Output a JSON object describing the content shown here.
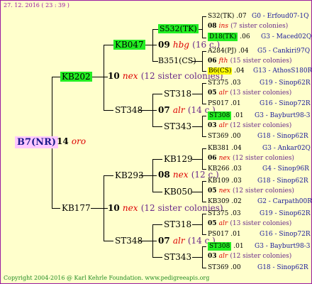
{
  "header": {
    "date": "27. 12. 2016 ( 23 : 39 )"
  },
  "footer": {
    "copyright": "Copyright 2004-2016 @ Karl Kehrle Foundation.   www.pedigreeapis.org"
  },
  "root": {
    "name": "B7(NR)",
    "gen": "14",
    "race": "oro"
  },
  "sire": {
    "name": "KB202",
    "gen": "10",
    "race": "nex",
    "sisters": "(12 sister colonies)"
  },
  "dam": {
    "name": "KB177",
    "gen": "10",
    "race": "nex",
    "sisters": "(12 sister colonies)"
  },
  "sire_sire": {
    "name": "KB047"
  },
  "sire_dam": {
    "name": "ST348",
    "gen": "07",
    "race": "alr",
    "sisters": "(14 c.)"
  },
  "dam_sire": {
    "name": "KB293",
    "gen": "08",
    "race": "nex",
    "sisters": "(12 c.)"
  },
  "dam_dam": {
    "name": "ST348",
    "gen": "07",
    "race": "alr",
    "sisters": "(14 c.)"
  },
  "g3": {
    "s532": {
      "name": "S532(TK)"
    },
    "b351": {
      "name": "B351(CS)"
    },
    "mid_gen": {
      "gen": "09",
      "race": "hbg",
      "sisters": "(16 c.)"
    },
    "st318a": {
      "name": "ST318"
    },
    "st343a": {
      "name": "ST343"
    },
    "kb129": {
      "name": "KB129"
    },
    "kb050": {
      "name": "KB050"
    },
    "st318b": {
      "name": "ST318"
    },
    "st343b": {
      "name": "ST343"
    }
  },
  "g4": [
    {
      "id": "S32(TK)",
      "year": ".07",
      "country": "G0 - Erfoud07-1Q"
    },
    {
      "gen": "08",
      "race": "ins",
      "sis": "(7 sister colonies)"
    },
    {
      "id": "D18(TK)",
      "year": ".06",
      "country": "G3 - Maced02Q"
    },
    {
      "id": "A284(PJ)",
      "year": ".04",
      "country": "G5 - Cankiri97Q"
    },
    {
      "gen": "06",
      "race": "fth",
      "sis": "(15 sister colonies)"
    },
    {
      "id": "B6(CS)",
      "year": ".04",
      "country": "G13 - AthosS180R"
    },
    {
      "id": "ST375",
      "year": ".03",
      "country": "G19 - Sinop62R"
    },
    {
      "gen": "05",
      "race": "alr",
      "sis": "(13 sister colonies)"
    },
    {
      "id": "PS017",
      "year": ".01",
      "country": "G16 - Sinop72R"
    },
    {
      "id": "ST308",
      "year": ".01",
      "country": "G3 - Bayburt98-3"
    },
    {
      "gen": "03",
      "race": "alr",
      "sis": "(12 sister colonies)"
    },
    {
      "id": "ST369",
      "year": ".00",
      "country": "G18 - Sinop62R"
    },
    {
      "id": "KB381",
      "year": ".04",
      "country": "G3 - Ankar02Q"
    },
    {
      "gen": "06",
      "race": "nex",
      "sis": "(12 sister colonies)"
    },
    {
      "id": "KB266",
      "year": ".03",
      "country": "G4 - Sinop96R"
    },
    {
      "id": "KB109",
      "year": ".03",
      "country": "G18 - Sinop62R"
    },
    {
      "gen": "05",
      "race": "nex",
      "sis": "(12 sister colonies)"
    },
    {
      "id": "KB309",
      "year": ".02",
      "country": "G2 - Carpath00R"
    },
    {
      "id": "ST375",
      "year": ".03",
      "country": "G19 - Sinop62R"
    },
    {
      "gen": "05",
      "race": "alr",
      "sis": "(13 sister colonies)"
    },
    {
      "id": "PS017",
      "year": ".01",
      "country": "G16 - Sinop72R"
    },
    {
      "id": "ST308",
      "year": ".01",
      "country": "G3 - Bayburt98-3"
    },
    {
      "gen": "03",
      "race": "alr",
      "sis": "(12 sister colonies)"
    },
    {
      "id": "ST369",
      "year": ".00",
      "country": "G18 - Sinop62R"
    }
  ]
}
